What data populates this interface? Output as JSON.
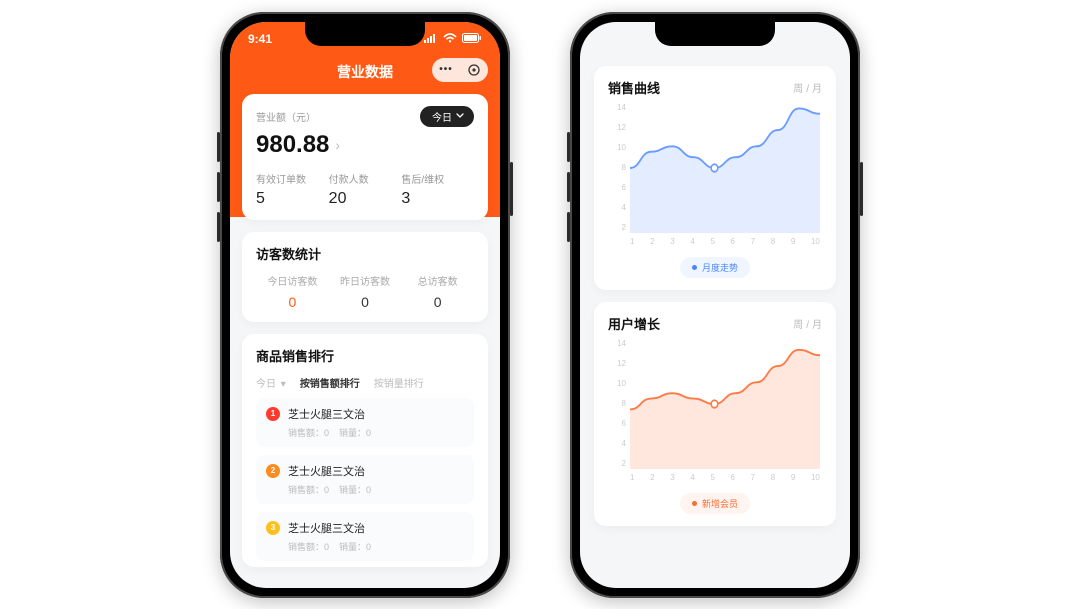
{
  "statusbar": {
    "time": "9:41"
  },
  "left": {
    "title": "营业数据",
    "revenue": {
      "label": "营业额（元）",
      "amount": "980.88",
      "range_label": "今日",
      "stats": [
        {
          "label": "有效订单数",
          "value": "5"
        },
        {
          "label": "付款人数",
          "value": "20"
        },
        {
          "label": "售后/维权",
          "value": "3"
        }
      ]
    },
    "visitors": {
      "title": "访客数统计",
      "cells": [
        {
          "label": "今日访客数",
          "value": "0",
          "accent": true
        },
        {
          "label": "昨日访客数",
          "value": "0"
        },
        {
          "label": "总访客数",
          "value": "0"
        }
      ]
    },
    "ranking": {
      "title": "商品销售排行",
      "range_label": "今日",
      "tabs": [
        {
          "label": "按销售额排行",
          "active": true
        },
        {
          "label": "按销量排行"
        }
      ],
      "items": [
        {
          "rank": "1",
          "name": "芝士火腿三文治",
          "sales_label": "销售额：",
          "sales": "0",
          "qty_label": "销量：",
          "qty": "0"
        },
        {
          "rank": "2",
          "name": "芝士火腿三文治",
          "sales_label": "销售额：",
          "sales": "0",
          "qty_label": "销量：",
          "qty": "0"
        },
        {
          "rank": "3",
          "name": "芝士火腿三文治",
          "sales_label": "销售额：",
          "sales": "0",
          "qty_label": "销量：",
          "qty": "0"
        }
      ]
    }
  },
  "right": {
    "sales": {
      "title": "销售曲线",
      "week_label": "周",
      "month_label": "月",
      "legend": "月度走势"
    },
    "users": {
      "title": "用户增长",
      "week_label": "周",
      "month_label": "月",
      "legend": "新增会员"
    }
  },
  "chart_data": [
    {
      "type": "line",
      "title": "销售曲线",
      "legend": [
        "月度走势"
      ],
      "x": [
        1,
        2,
        3,
        4,
        5,
        6,
        7,
        8,
        9,
        10
      ],
      "series": [
        {
          "name": "月度走势",
          "values": [
            8,
            9.5,
            10,
            9,
            8,
            9,
            10,
            11.5,
            13.5,
            13
          ]
        }
      ],
      "ylim": [
        2,
        14
      ],
      "y_ticks": [
        2,
        4,
        6,
        8,
        10,
        12,
        14
      ],
      "xlabel": "",
      "ylabel": "",
      "marker_at_x": 5
    },
    {
      "type": "line",
      "title": "用户增长",
      "legend": [
        "新增会员"
      ],
      "x": [
        1,
        2,
        3,
        4,
        5,
        6,
        7,
        8,
        9,
        10
      ],
      "series": [
        {
          "name": "新增会员",
          "values": [
            7.5,
            8.5,
            9,
            8.5,
            8,
            9,
            10,
            11.5,
            13,
            12.5
          ]
        }
      ],
      "ylim": [
        2,
        14
      ],
      "y_ticks": [
        2,
        4,
        6,
        8,
        10,
        12,
        14
      ],
      "xlabel": "",
      "ylabel": "",
      "marker_at_x": 5
    }
  ]
}
